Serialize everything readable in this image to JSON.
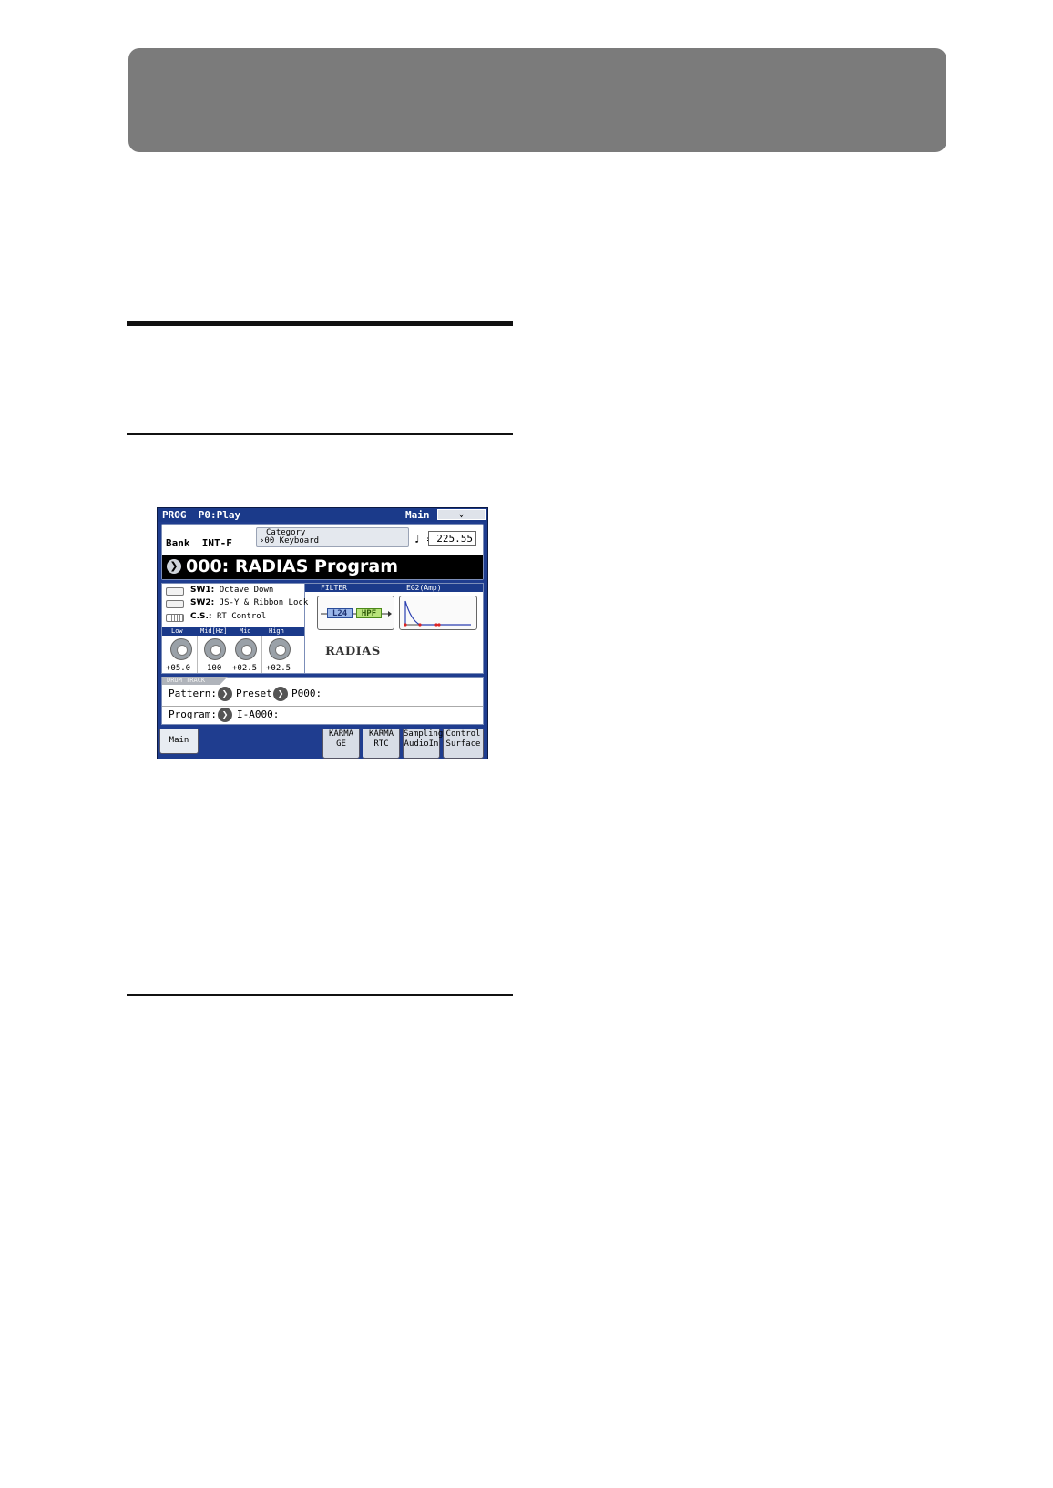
{
  "screen": {
    "mode": "PROG",
    "page": "P0:Play",
    "tab_label": "Main",
    "page_menu_icon": "chevron-down-icon",
    "bank_label": "Bank",
    "bank_value": "INT-F",
    "category_label": "Category",
    "category_value": "00 Keyboard",
    "tempo_symbol": "♩ =",
    "tempo_value": "225.55",
    "program_name": "000: RADIAS Program",
    "sw1_label": "SW1:",
    "sw1_value": "Octave Down",
    "sw2_label": "SW2:",
    "sw2_value": "JS-Y & Ribbon Lock",
    "cs_label": "C.S.:",
    "cs_value": "RT Control",
    "eq": {
      "headers": [
        "Low",
        "Mid[Hz]",
        "Mid",
        "High"
      ],
      "values": [
        "+05.0",
        "100",
        "+02.5",
        "+02.5"
      ]
    },
    "filter_label": "FILTER",
    "eg_label": "EG2(Amp)",
    "filter1": "L24",
    "filter2": "HPF",
    "logo_text": "RADIAS",
    "drum_track_label": "DRUM TRACK",
    "pattern_label": "Pattern:",
    "pattern_bank": "Preset",
    "pattern_value": "P000:",
    "program_label": "Program:",
    "program_value": "I-A000:",
    "tabs": {
      "main": "Main",
      "karma_ge_1": "KARMA",
      "karma_ge_2": "GE",
      "karma_rtc_1": "KARMA",
      "karma_rtc_2": "RTC",
      "sampling_1": "Sampling",
      "sampling_2": "AudioIn",
      "control_1": "Control",
      "control_2": "Surface"
    }
  },
  "colors": {
    "frame_blue": "#1f3d8f",
    "banner_gray": "#7b7b7b"
  }
}
